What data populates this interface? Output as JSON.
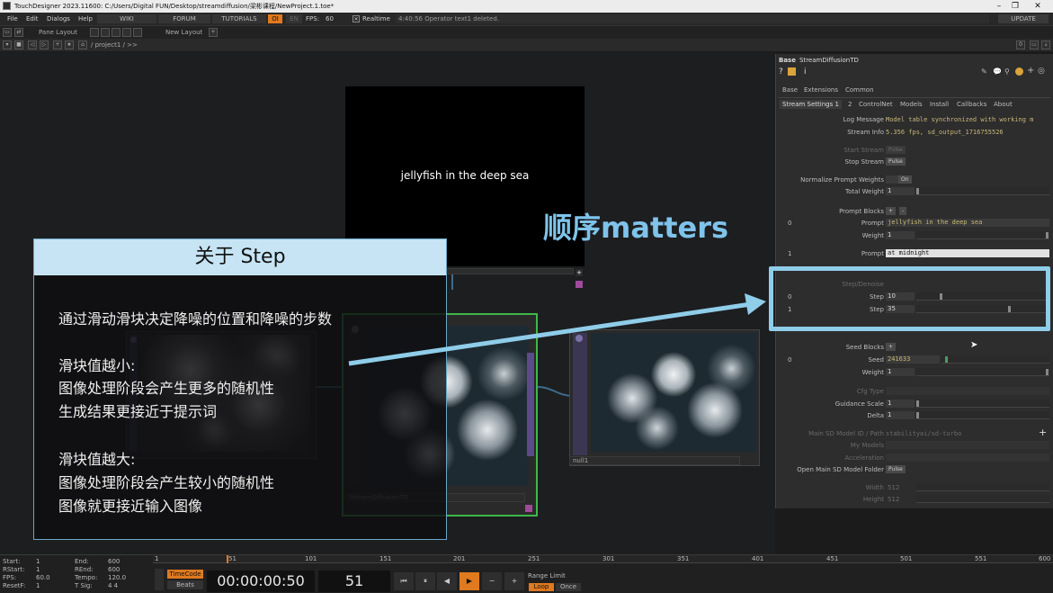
{
  "window": {
    "title": "TouchDesigner 2023.11600: C:/Users/Digital FUN/Desktop/streamdiffusion/梁彬课程/NewProject.1.toe*"
  },
  "menu": {
    "file": "File",
    "edit": "Edit",
    "dialogs": "Dialogs",
    "help": "Help",
    "wiki": "WIKI",
    "forum": "FORUM",
    "tutorials": "TUTORIALS",
    "oi": "OI",
    "en": "EN",
    "fps": "FPS:",
    "fps_value": "60",
    "realtime": "Realtime",
    "status": "4:40:56 Operator text1 deleted.",
    "update": "UPDATE"
  },
  "toolbar": {
    "pane_layout": "Pane Layout",
    "new_layout": "New Layout",
    "path": "/ project1 / >>",
    "zero": "0"
  },
  "network": {
    "text_top": "jellyfish in the deep sea",
    "op_diffusion": "StreamDiffusionTD",
    "op_null": "null1"
  },
  "overlay": {
    "card_title": "关于 Step",
    "lines": [
      "通过滑动滑块决定降噪的位置和降噪的步数",
      "滑块值越小:",
      "图像处理阶段会产生更多的随机性",
      "生成结果更接近于提示词",
      "滑块值越大:",
      "图像处理阶段会产生较小的随机性",
      "图像就更接近输入图像"
    ],
    "matters": "顺序matters"
  },
  "params": {
    "op_type": "Base",
    "op_name": "StreamDiffusionTD",
    "tabs_row1": [
      "Base",
      "Extensions",
      "Common"
    ],
    "tabs_row2": [
      "Stream Settings 1",
      "2",
      "ControlNet",
      "Models",
      "Install",
      "Callbacks",
      "About"
    ],
    "log_label": "Log Message",
    "log_value": "Model table synchronized with working m",
    "stream_label": "Stream Info",
    "stream_value": "5.356 fps, sd_output_1716755526",
    "start_stream": "Start Stream",
    "start_btn": "Pulse",
    "stop_stream": "Stop Stream",
    "stop_btn": "Pulse",
    "normalize_label": "Normalize Prompt Weights",
    "normalize_value": "On",
    "total_weight_label": "Total Weight",
    "total_weight_value": "1",
    "prompt_blocks": "Prompt Blocks",
    "prompt0_idx": "0",
    "prompt_label": "Prompt",
    "prompt0_value": "jellyfish in the deep sea",
    "weight_label": "Weight",
    "prompt0_weight": "1",
    "prompt1_idx": "1",
    "prompt1_value": "at midnight",
    "step_section": "Step/Denoise",
    "step_label": "Step",
    "step0_idx": "0",
    "step0_value": "10",
    "step1_idx": "1",
    "step1_value": "35",
    "seed_blocks": "Seed Blocks",
    "seed_label": "Seed",
    "seed_idx": "0",
    "seed_value": "241633",
    "seed_weight": "1",
    "cfg_label": "Cfg Type",
    "guidance_label": "Guidance Scale",
    "guidance_value": "1",
    "delta_label": "Delta",
    "delta_value": "1",
    "model_label": "Main SD Model ID / Path",
    "model_value": "stabilityai/sd-turbo",
    "my_models": "My Models",
    "acceleration": "Acceleration",
    "open_folder": "Open Main SD Model Folder",
    "open_btn": "Pulse",
    "width_label": "Width",
    "width_value": "512",
    "height_label": "Height",
    "height_value": "512"
  },
  "timeline": {
    "start_l": "Start:",
    "start_v": "1",
    "rstart_l": "RStart:",
    "rstart_v": "1",
    "fps_l": "FPS:",
    "fps_v": "60.0",
    "resetf_l": "ResetF:",
    "resetf_v": "1",
    "end_l": "End:",
    "end_v": "600",
    "rend_l": "REnd:",
    "rend_v": "600",
    "tempo_l": "Tempo:",
    "tempo_v": "120.0",
    "tsig_l": "T Sig:",
    "tsig_v": "4    4",
    "timecode": "TimeCode",
    "beats": "Beats",
    "time": "00:00:00:50",
    "frame": "51",
    "range_limit": "Range Limit",
    "loop": "Loop",
    "once": "Once",
    "ruler": [
      "1",
      "51",
      "101",
      "151",
      "201",
      "251",
      "301",
      "351",
      "401",
      "451",
      "501",
      "551",
      "600"
    ]
  },
  "colors": {
    "accent": "#8fcde9",
    "highlight_orange": "#e07a1f",
    "selected_green": "#3fb84a"
  }
}
